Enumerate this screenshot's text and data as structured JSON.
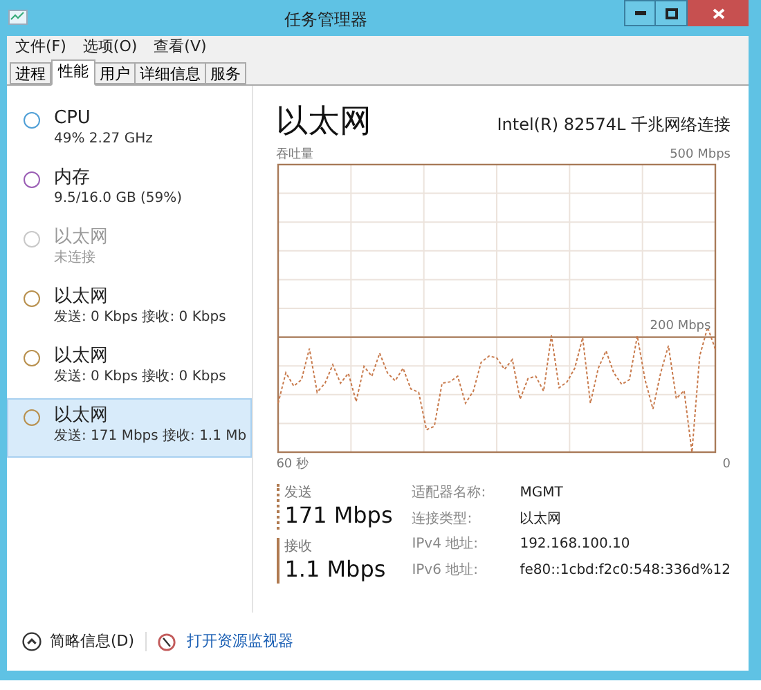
{
  "window": {
    "title": "任务管理器"
  },
  "menu": [
    "文件(F)",
    "选项(O)",
    "查看(V)"
  ],
  "tabs": [
    {
      "label": "进程",
      "selected": false
    },
    {
      "label": "性能",
      "selected": true
    },
    {
      "label": "用户",
      "selected": false
    },
    {
      "label": "详细信息",
      "selected": false
    },
    {
      "label": "服务",
      "selected": false
    }
  ],
  "sidebar": {
    "items": [
      {
        "title": "CPU",
        "subtitle": "49% 2.27 GHz",
        "color": "#4f9fd6",
        "connected": true,
        "selected": false
      },
      {
        "title": "内存",
        "subtitle": "9.5/16.0 GB (59%)",
        "color": "#9a5db4",
        "connected": true,
        "selected": false
      },
      {
        "title": "以太网",
        "subtitle": "未连接",
        "color": "#c8c8c8",
        "connected": false,
        "selected": false
      },
      {
        "title": "以太网",
        "subtitle": "发送: 0 Kbps 接收: 0 Kbps",
        "color": "#b8904e",
        "connected": true,
        "selected": false
      },
      {
        "title": "以太网",
        "subtitle": "发送: 0 Kbps 接收: 0 Kbps",
        "color": "#b8904e",
        "connected": true,
        "selected": false
      },
      {
        "title": "以太网",
        "subtitle": "发送: 171 Mbps 接收: 1.1 Mb",
        "color": "#b8904e",
        "connected": true,
        "selected": true
      }
    ]
  },
  "detail": {
    "title": "以太网",
    "adapter": "Intel(R) 82574L 千兆网络连接",
    "graph": {
      "title": "吞吐量",
      "max_label": "500 Mbps",
      "ref_label": "200 Mbps",
      "start_label": "60 秒",
      "end_label": "0"
    },
    "stats": [
      {
        "kind": "send",
        "label": "发送",
        "value": "171 Mbps"
      },
      {
        "kind": "receive",
        "label": "接收",
        "value": "1.1 Mbps"
      }
    ],
    "properties": [
      {
        "label": "适配器名称:",
        "value": "MGMT"
      },
      {
        "label": "连接类型:",
        "value": "以太网"
      },
      {
        "label": "IPv4 地址:",
        "value": "192.168.100.10"
      },
      {
        "label": "IPv6 地址:",
        "value": "fe80::1cbd:f2c0:548:336d%12"
      }
    ]
  },
  "footer": {
    "collapse": "简略信息(D)",
    "link": "打开资源监视器"
  }
}
